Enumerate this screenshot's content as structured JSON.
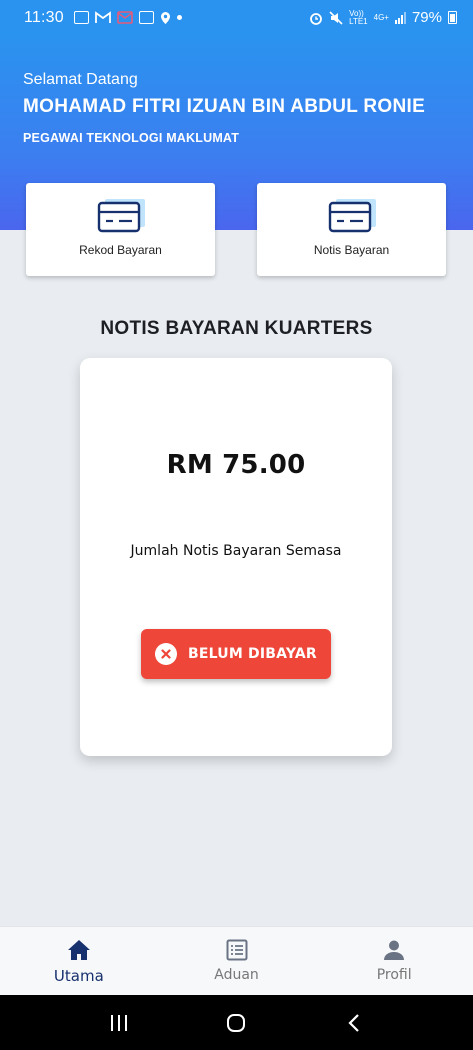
{
  "status_bar": {
    "time": "11:30",
    "battery": "79%",
    "network_top": "4G+",
    "network_sub": "LTE1",
    "volte": "Vo))"
  },
  "header": {
    "greeting": "Selamat Datang",
    "user_name": "MOHAMAD FITRI IZUAN BIN ABDUL RONIE",
    "user_title": "PEGAWAI TEKNOLOGI MAKLUMAT"
  },
  "quick_actions": [
    {
      "label": "Rekod Bayaran",
      "icon": "payment-card-icon"
    },
    {
      "label": "Notis Bayaran",
      "icon": "payment-card-icon"
    }
  ],
  "notice": {
    "section_title": "NOTIS BAYARAN KUARTERS",
    "amount": "RM 75.00",
    "caption": "Jumlah Notis Bayaran Semasa",
    "status_label": "BELUM DIBAYAR",
    "status_color": "#ee4638"
  },
  "bottom_nav": {
    "items": [
      {
        "label": "Utama",
        "icon": "home-icon",
        "active": true
      },
      {
        "label": "Aduan",
        "icon": "list-icon",
        "active": false
      },
      {
        "label": "Profil",
        "icon": "person-icon",
        "active": false
      }
    ]
  },
  "colors": {
    "header_top": "#2a93ef",
    "header_bottom": "#4a66ee",
    "accent": "#17306e",
    "background": "#e9edf1"
  }
}
